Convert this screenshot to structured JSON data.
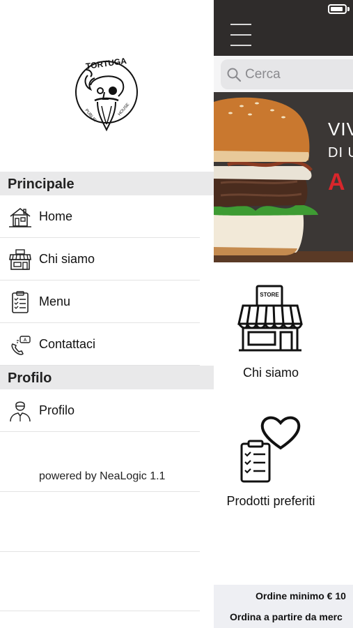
{
  "drawer": {
    "logo_text": "TORTUGA",
    "logo_sub_left": "PUBLIC",
    "logo_sub_right": "HOUSE",
    "sections": [
      {
        "title": "Principale",
        "items": [
          {
            "label": "Home",
            "icon": "home-icon"
          },
          {
            "label": "Chi siamo",
            "icon": "store-icon"
          },
          {
            "label": "Menu",
            "icon": "clipboard-list-icon"
          },
          {
            "label": "Contattaci",
            "icon": "phone-chat-icon"
          }
        ]
      },
      {
        "title": "Profilo",
        "items": [
          {
            "label": "Profilo",
            "icon": "user-icon"
          }
        ]
      }
    ],
    "powered_by": "powered by NeaLogic 1.1"
  },
  "main": {
    "search": {
      "placeholder": "Cerca"
    },
    "banner": {
      "line1": "VIV",
      "line2": "DI U",
      "line3": "A C",
      "accent_color": "#d8262b"
    },
    "tiles": [
      {
        "label": "Chi siamo",
        "icon": "store-icon",
        "icon_text": "STORE"
      },
      {
        "label": "Prodotti preferiti",
        "icon": "heart-clipboard-icon"
      }
    ],
    "footer": {
      "line1": "Ordine minimo € 10",
      "line2": "Ordina a partire da merc"
    }
  },
  "colors": {
    "topbar": "#2f2c2b",
    "section_header": "#e9e9ea",
    "footer_bg": "#eeeff3"
  }
}
